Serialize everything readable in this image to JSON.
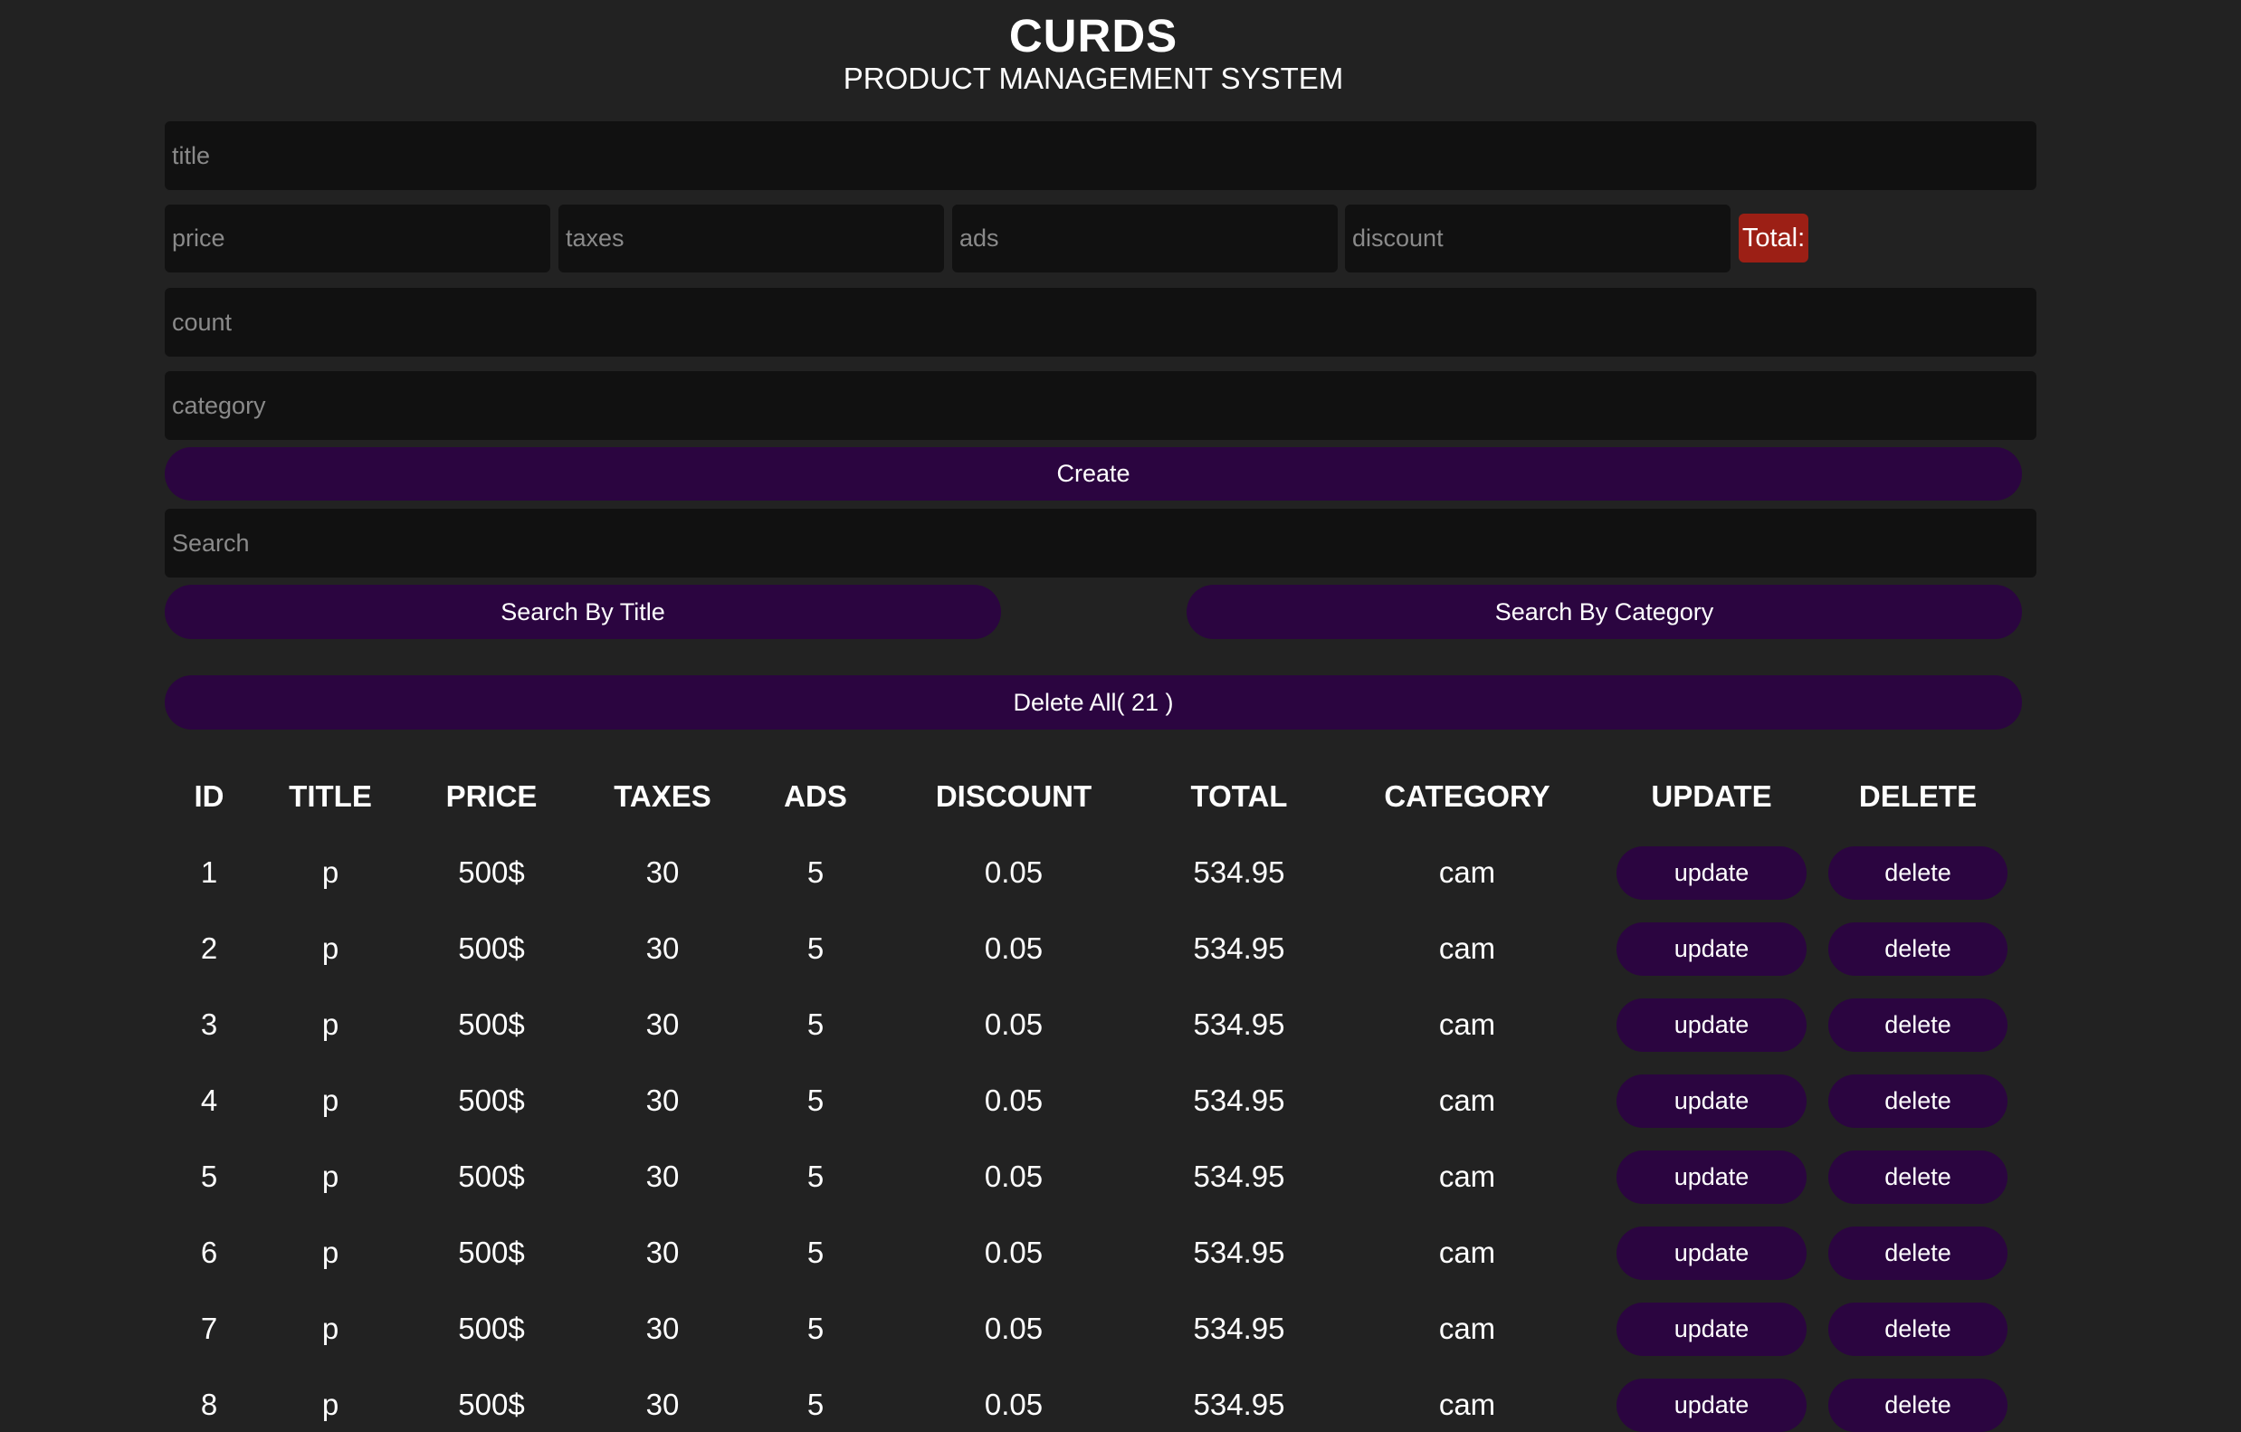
{
  "header": {
    "title": "CURDS",
    "subtitle": "PRODUCT MANAGEMENT SYSTEM"
  },
  "form": {
    "title_placeholder": "title",
    "price_placeholder": "price",
    "taxes_placeholder": "taxes",
    "ads_placeholder": "ads",
    "discount_placeholder": "discount",
    "total_label": "Total:",
    "count_placeholder": "count",
    "category_placeholder": "category",
    "create_label": "Create"
  },
  "search": {
    "placeholder": "Search",
    "by_title_label": "Search By Title",
    "by_category_label": "Search By Category"
  },
  "delete_all_label": "Delete All( 21 )",
  "table": {
    "columns": [
      "ID",
      "TITLE",
      "PRICE",
      "TAXES",
      "ADS",
      "DISCOUNT",
      "TOTAL",
      "CATEGORY",
      "UPDATE",
      "DELETE"
    ],
    "update_label": "update",
    "delete_label": "delete",
    "rows": [
      {
        "id": "1",
        "title": "p",
        "price": "500$",
        "taxes": "30",
        "ads": "5",
        "discount": "0.05",
        "total": "534.95",
        "category": "cam"
      },
      {
        "id": "2",
        "title": "p",
        "price": "500$",
        "taxes": "30",
        "ads": "5",
        "discount": "0.05",
        "total": "534.95",
        "category": "cam"
      },
      {
        "id": "3",
        "title": "p",
        "price": "500$",
        "taxes": "30",
        "ads": "5",
        "discount": "0.05",
        "total": "534.95",
        "category": "cam"
      },
      {
        "id": "4",
        "title": "p",
        "price": "500$",
        "taxes": "30",
        "ads": "5",
        "discount": "0.05",
        "total": "534.95",
        "category": "cam"
      },
      {
        "id": "5",
        "title": "p",
        "price": "500$",
        "taxes": "30",
        "ads": "5",
        "discount": "0.05",
        "total": "534.95",
        "category": "cam"
      },
      {
        "id": "6",
        "title": "p",
        "price": "500$",
        "taxes": "30",
        "ads": "5",
        "discount": "0.05",
        "total": "534.95",
        "category": "cam"
      },
      {
        "id": "7",
        "title": "p",
        "price": "500$",
        "taxes": "30",
        "ads": "5",
        "discount": "0.05",
        "total": "534.95",
        "category": "cam"
      },
      {
        "id": "8",
        "title": "p",
        "price": "500$",
        "taxes": "30",
        "ads": "5",
        "discount": "0.05",
        "total": "534.95",
        "category": "cam"
      }
    ]
  }
}
